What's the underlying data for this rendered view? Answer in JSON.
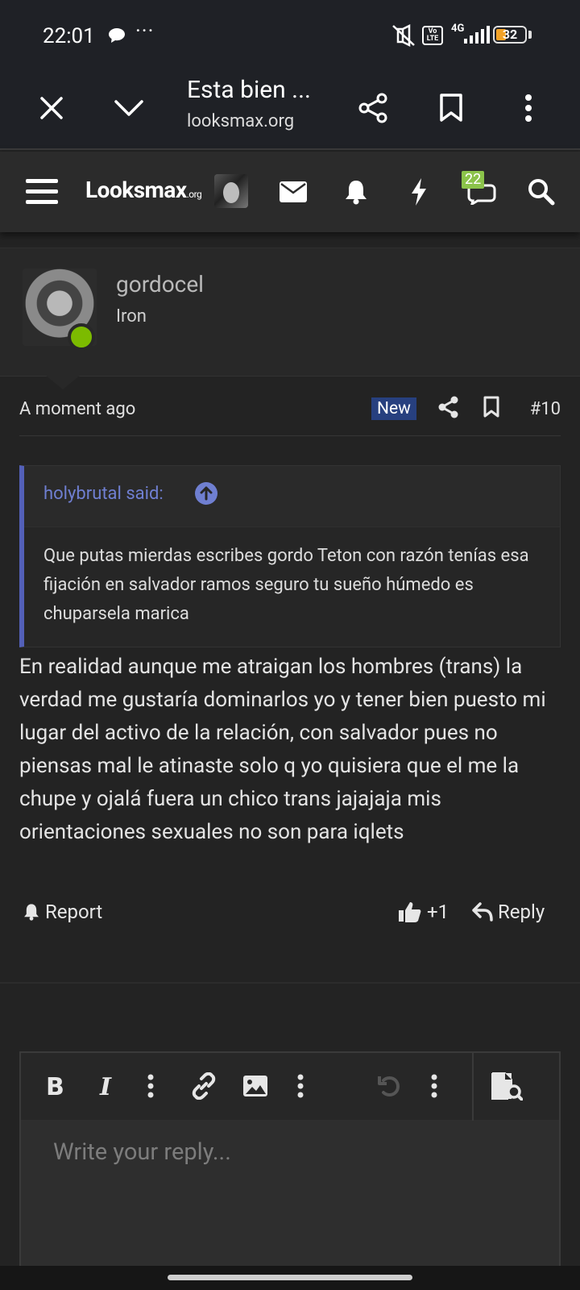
{
  "status_bar": {
    "time": "22:01",
    "dots": "···",
    "network": "4G",
    "volte": "Vo LTE",
    "battery": "32"
  },
  "browser": {
    "title": "Esta bien ...",
    "url": "looksmax.org"
  },
  "site_nav": {
    "logo_main": "Looksmax",
    "logo_suffix": ".org",
    "chat_badge": "22"
  },
  "post": {
    "username": "gordocel",
    "user_title": "Iron",
    "time": "A moment ago",
    "new_label": "New",
    "number": "#10",
    "quote": {
      "author": "holybrutal said:",
      "text": "Que putas mierdas escribes gordo Teton con razón tenías esa fijación en salvador ramos seguro tu sueño húmedo es chuparsela marica"
    },
    "body": "En realidad aunque me atraigan los hombres (trans) la verdad me gustaría dominarlos yo y tener bien puesto mi lugar del activo de la relación, con salvador pues no piensas mal le atinaste solo q yo quisiera que el me la chupe y ojalá fuera un chico trans jajajaja mis orientaciones sexuales no son para iqlets",
    "actions": {
      "report": "Report",
      "like": "+1",
      "reply": "Reply"
    }
  },
  "editor": {
    "placeholder": "Write your reply..."
  },
  "colors": {
    "background": "#232323",
    "quote_accent": "#5360b8",
    "online": "#7cbb00",
    "new_badge": "#27407f",
    "badge": "#8bc34a"
  }
}
